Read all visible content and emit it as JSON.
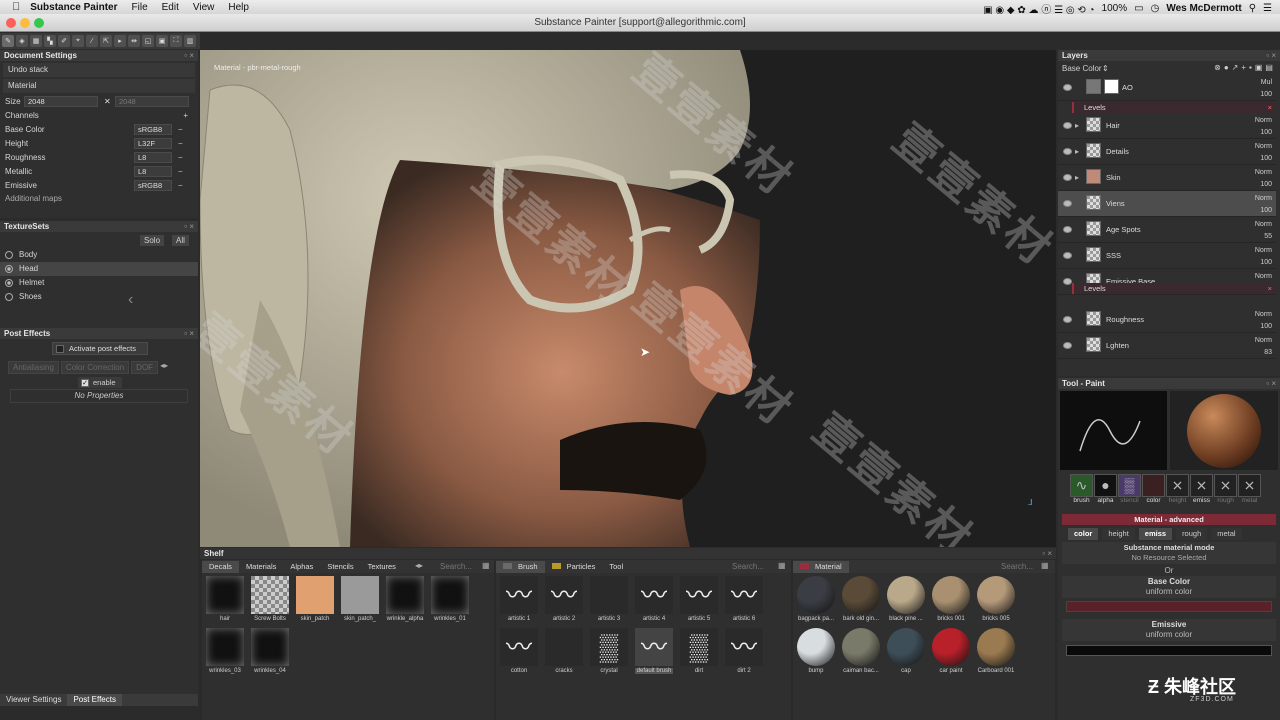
{
  "menubar": {
    "apple_icon": "apple-logo-icon",
    "app": "Substance Painter",
    "items": [
      "File",
      "Edit",
      "View",
      "Help"
    ],
    "battery": "100%",
    "user": "Wes McDermott"
  },
  "window": {
    "title": "Substance Painter [support@allegorithmic.com]"
  },
  "document_settings": {
    "title": "Document Settings",
    "undo": "Undo stack",
    "material": "Material",
    "size_label": "Size",
    "size_value": "2048",
    "size_value2": "2048",
    "channels_label": "Channels",
    "channels": [
      {
        "name": "Base Color",
        "fmt": "sRGB8"
      },
      {
        "name": "Height",
        "fmt": "L32F"
      },
      {
        "name": "Roughness",
        "fmt": "L8"
      },
      {
        "name": "Metallic",
        "fmt": "L8"
      },
      {
        "name": "Emissive",
        "fmt": "sRGB8"
      }
    ],
    "additional": "Additional maps"
  },
  "texturesets": {
    "title": "TextureSets",
    "solo": "Solo",
    "all": "All",
    "items": [
      "Body",
      "Head",
      "Helmet",
      "Shoes"
    ]
  },
  "post_effects": {
    "title": "Post Effects",
    "activate": "Activate post effects",
    "tabs": [
      "Antialiasing",
      "Color Correction",
      "DOF"
    ],
    "enable": "enable",
    "none": "No Properties"
  },
  "bottom_tabs": [
    "Viewer Settings",
    "Post Effects"
  ],
  "viewport": {
    "label": "Material - pbr-metal-rough",
    "watermark": "壹壹素材"
  },
  "layers": {
    "title": "Layers",
    "channel": "Base Color",
    "rows": [
      {
        "name": "AO",
        "blend": "Mul",
        "opacity": "100"
      },
      {
        "name": "Hair",
        "blend": "Norm",
        "opacity": "100"
      },
      {
        "name": "Details",
        "blend": "Norm",
        "opacity": "100"
      },
      {
        "name": "Skin",
        "blend": "Norm",
        "opacity": "100"
      },
      {
        "name": "Viens",
        "blend": "Norm",
        "opacity": "100"
      },
      {
        "name": "Age Spots",
        "blend": "Norm",
        "opacity": "55"
      },
      {
        "name": "SSS",
        "blend": "Norm",
        "opacity": "100"
      },
      {
        "name": "Emissive Base",
        "blend": "Norm",
        "opacity": "100"
      },
      {
        "name": "Roughness",
        "blend": "Norm",
        "opacity": "100"
      },
      {
        "name": "Lghten",
        "blend": "Norm",
        "opacity": "83"
      }
    ],
    "levels": "Levels",
    "levels2": "Levels"
  },
  "tool": {
    "title": "Tool - Paint",
    "slots": [
      "brush",
      "alpha",
      "stencil",
      "color",
      "height",
      "emiss",
      "rough",
      "metal"
    ],
    "material_title": "Material - advanced",
    "channels": [
      "color",
      "height",
      "emiss",
      "rough",
      "metal"
    ],
    "mode_title": "Substance material mode",
    "mode_value": "No Resource Selected",
    "or": "Or",
    "base_color": "Base Color",
    "base_color_val": "uniform color",
    "emissive": "Emissive",
    "emissive_val": "uniform color"
  },
  "shelf": {
    "title": "Shelf",
    "tabs": [
      "Decals",
      "Materials",
      "Alphas",
      "Stencils",
      "Textures"
    ],
    "search": "Search...",
    "decals": [
      "hair",
      "Screw Bolts",
      "skin_patch",
      "skin_patch_",
      "wrinkle_alpha",
      "wrinkles_01",
      "wrinkles_03",
      "wrinkles_04"
    ],
    "brush_tabs": [
      "Brush",
      "Particles",
      "Tool"
    ],
    "brushes": [
      "artistic 1",
      "artistic 2",
      "artistic 3",
      "artistic 4",
      "artistic 5",
      "artistic 6",
      "cotton",
      "cracks",
      "crystal",
      "default brush",
      "dirt",
      "dirt 2"
    ],
    "material_tab": "Material",
    "materials": [
      "bagpack pa...",
      "bark old gin...",
      "black pine ...",
      "bricks 001",
      "bricks 005",
      "bump",
      "caiman bac...",
      "cap",
      "car paint",
      "Carboard 001"
    ]
  },
  "logo": {
    "text": "朱峰社区",
    "sub": "ZF3D.COM"
  },
  "colors": {
    "accent": "#9b2d3d",
    "panel": "#2f2f2f"
  }
}
